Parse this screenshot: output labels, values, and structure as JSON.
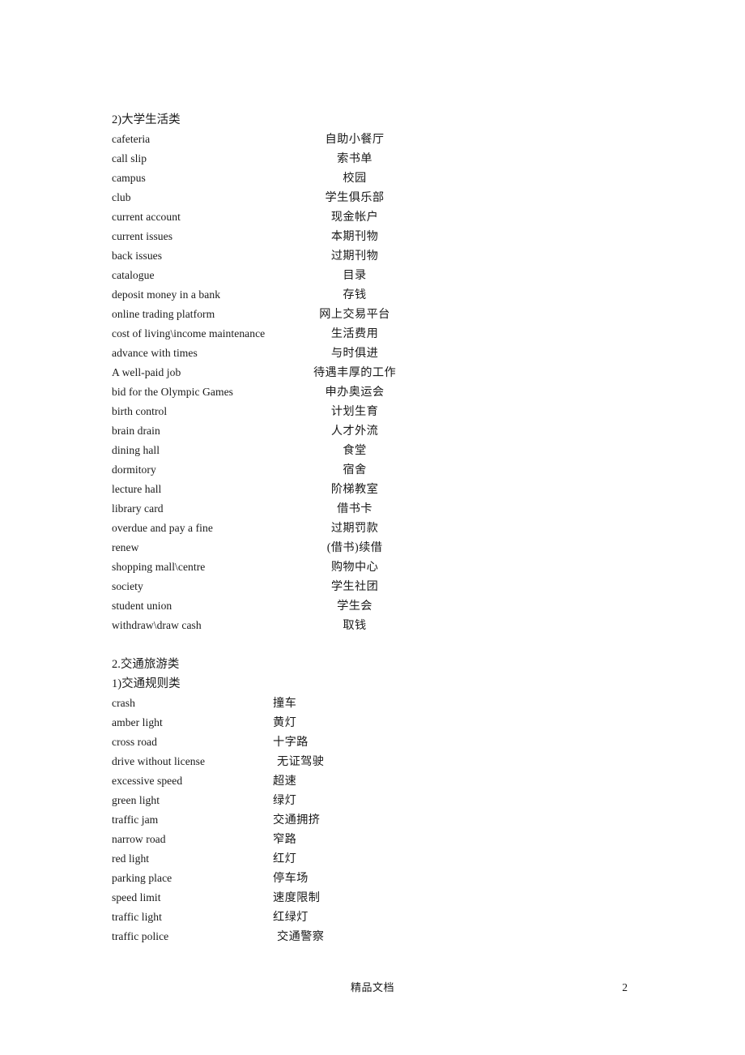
{
  "document": {
    "footer_text": "精品文档",
    "page_number": "2"
  },
  "sections": [
    {
      "id": "college-life",
      "heading": "2)大学生活类",
      "entries": [
        {
          "en": "cafeteria",
          "cn": "自助小餐厅"
        },
        {
          "en": "call slip",
          "cn": "索书单"
        },
        {
          "en": "campus",
          "cn": "校园"
        },
        {
          "en": "club",
          "cn": "学生俱乐部"
        },
        {
          "en": "current account",
          "cn": "现金帐户"
        },
        {
          "en": "current issues",
          "cn": "本期刊物"
        },
        {
          "en": "back issues",
          "cn": "过期刊物"
        },
        {
          "en": "catalogue",
          "cn": "目录"
        },
        {
          "en": "deposit money in a bank",
          "cn": "存钱"
        },
        {
          "en": "online trading platform",
          "cn": "网上交易平台"
        },
        {
          "en": "cost of living\\income maintenance",
          "cn": "生活费用"
        },
        {
          "en": "advance with times",
          "cn": "与时俱进"
        },
        {
          "en": "A well-paid job",
          "cn": "待遇丰厚的工作"
        },
        {
          "en": "bid for the Olympic Games",
          "cn": "申办奥运会"
        },
        {
          "en": "birth control",
          "cn": "计划生育"
        },
        {
          "en": "brain drain",
          "cn": "人才外流"
        },
        {
          "en": "dining hall",
          "cn": "食堂"
        },
        {
          "en": "dormitory",
          "cn": "宿舍"
        },
        {
          "en": "lecture hall",
          "cn": "阶梯教室"
        },
        {
          "en": "library card",
          "cn": "借书卡"
        },
        {
          "en": "overdue and pay a fine",
          "cn": "过期罚款"
        },
        {
          "en": "renew",
          "cn": "(借书)续借"
        },
        {
          "en": "shopping mall\\centre",
          "cn": "购物中心"
        },
        {
          "en": "society",
          "cn": "学生社团"
        },
        {
          "en": "student union",
          "cn": "学生会"
        },
        {
          "en": "withdraw\\draw cash",
          "cn": "取钱"
        }
      ]
    },
    {
      "id": "transport-travel",
      "heading": "2.交通旅游类",
      "subheading": "1)交通规则类",
      "entries": [
        {
          "en": "crash",
          "cn": "撞车",
          "indent": false
        },
        {
          "en": "amber light",
          "cn": "黄灯",
          "indent": false
        },
        {
          "en": "cross road",
          "cn": "十字路",
          "indent": false
        },
        {
          "en": "drive without license",
          "cn": "无证驾驶",
          "indent": true
        },
        {
          "en": "excessive speed",
          "cn": "超速",
          "indent": false
        },
        {
          "en": "green light",
          "cn": "绿灯",
          "indent": false
        },
        {
          "en": "traffic jam",
          "cn": "交通拥挤",
          "indent": false
        },
        {
          "en": "narrow road",
          "cn": "窄路",
          "indent": false
        },
        {
          "en": "red light",
          "cn": "红灯",
          "indent": false
        },
        {
          "en": "parking place",
          "cn": "停车场",
          "indent": false
        },
        {
          "en": "speed limit",
          "cn": "速度限制",
          "indent": false
        },
        {
          "en": "traffic light",
          "cn": "红绿灯",
          "indent": false
        },
        {
          "en": "traffic police",
          "cn": "交通警察",
          "indent": true
        }
      ]
    }
  ]
}
